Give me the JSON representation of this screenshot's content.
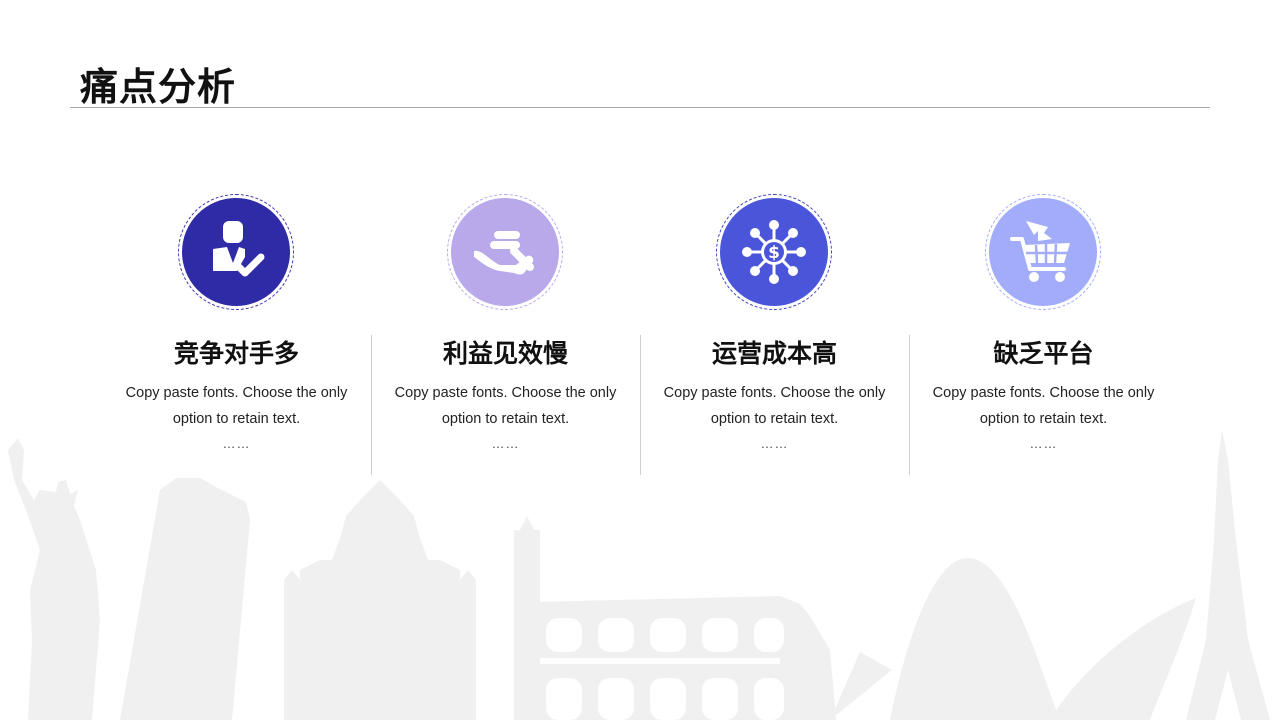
{
  "slide": {
    "title": "痛点分析"
  },
  "cards": [
    {
      "title": "竞争对手多",
      "desc": "Copy paste fonts. Choose the only option to retain text.",
      "more": "……",
      "icon": "businessman-check-icon",
      "color": "#2f2aa5",
      "ring_color": "#3b36b8"
    },
    {
      "title": "利益见效慢",
      "desc": "Copy paste fonts. Choose the only option to retain text.",
      "more": "……",
      "icon": "hand-coins-icon",
      "color": "#b9a8ea",
      "ring_color": "#b9a8ea"
    },
    {
      "title": "运营成本高",
      "desc": "Copy paste fonts. Choose the only option to retain text.",
      "more": "……",
      "icon": "dollar-network-icon",
      "color": "#4a55d9",
      "ring_color": "#3e44c4"
    },
    {
      "title": "缺乏平台",
      "desc": "Copy paste fonts. Choose the only option to retain text.",
      "more": "……",
      "icon": "shopping-cart-icon",
      "color": "#a3acf8",
      "ring_color": "#a3acf8"
    }
  ],
  "theme": {
    "skyline_color": "#efefef",
    "rule_color": "#a8a8a8"
  }
}
